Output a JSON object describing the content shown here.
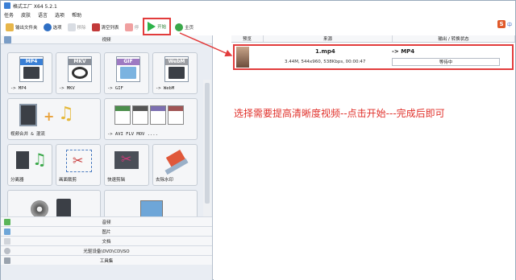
{
  "window": {
    "title": "格式工厂 X64 5.2.1"
  },
  "menu": [
    "任务",
    "皮肤",
    "语言",
    "选项",
    "帮助"
  ],
  "toolbar": {
    "output_folder": "输出文件夹",
    "options": "选项",
    "remove": "移除",
    "clear_list": "清空列表",
    "stop": "停",
    "start": "开始",
    "home": "主页"
  },
  "tray": {
    "s": "S",
    "zh": "中"
  },
  "left": {
    "video_section": "视频",
    "tiles": [
      {
        "label": "-> MP4",
        "icon": "mp4-file-icon",
        "band": "MP4",
        "color": "#3a7fd5"
      },
      {
        "label": "-> MKV",
        "icon": "mkv-file-icon",
        "band": "MKV",
        "color": "#8a8f98"
      },
      {
        "label": "-> GIF",
        "icon": "gif-file-icon",
        "band": "GIF",
        "color": "#9e7ac2"
      },
      {
        "label": "-> WebM",
        "icon": "webm-file-icon",
        "band": "WebM",
        "color": "#9c9ea3"
      },
      {
        "label": "视频合并 & 混流",
        "icon": "video-merge-icon"
      },
      {
        "label": "-> AVI FLV MOV ....",
        "icon": "multi-format-icon"
      },
      {
        "label": "分离器",
        "icon": "splitter-icon"
      },
      {
        "label": "画面裁剪",
        "icon": "crop-icon"
      },
      {
        "label": "快速剪辑",
        "icon": "quick-cut-icon"
      },
      {
        "label": "去除水印",
        "icon": "remove-watermark-icon"
      }
    ],
    "categories": [
      "音频",
      "图片",
      "文档",
      "光驱设备\\DVD\\CD\\ISO",
      "工具集"
    ]
  },
  "task_list": {
    "columns": [
      "预览",
      "来源",
      "输出 / 转换状态"
    ],
    "rows": [
      {
        "source_name": "1.mp4",
        "source_info": "3.44M, 544x960, 538Kbps, 00:00:47",
        "target": "-> MP4",
        "status": "等待中"
      }
    ]
  },
  "annotation": "选择需要提高清晰度视频--点击开始---完成后即可",
  "colors": {
    "highlight": "#e23c3c",
    "start_green": "#2db34a",
    "annotation": "#e0302a"
  }
}
